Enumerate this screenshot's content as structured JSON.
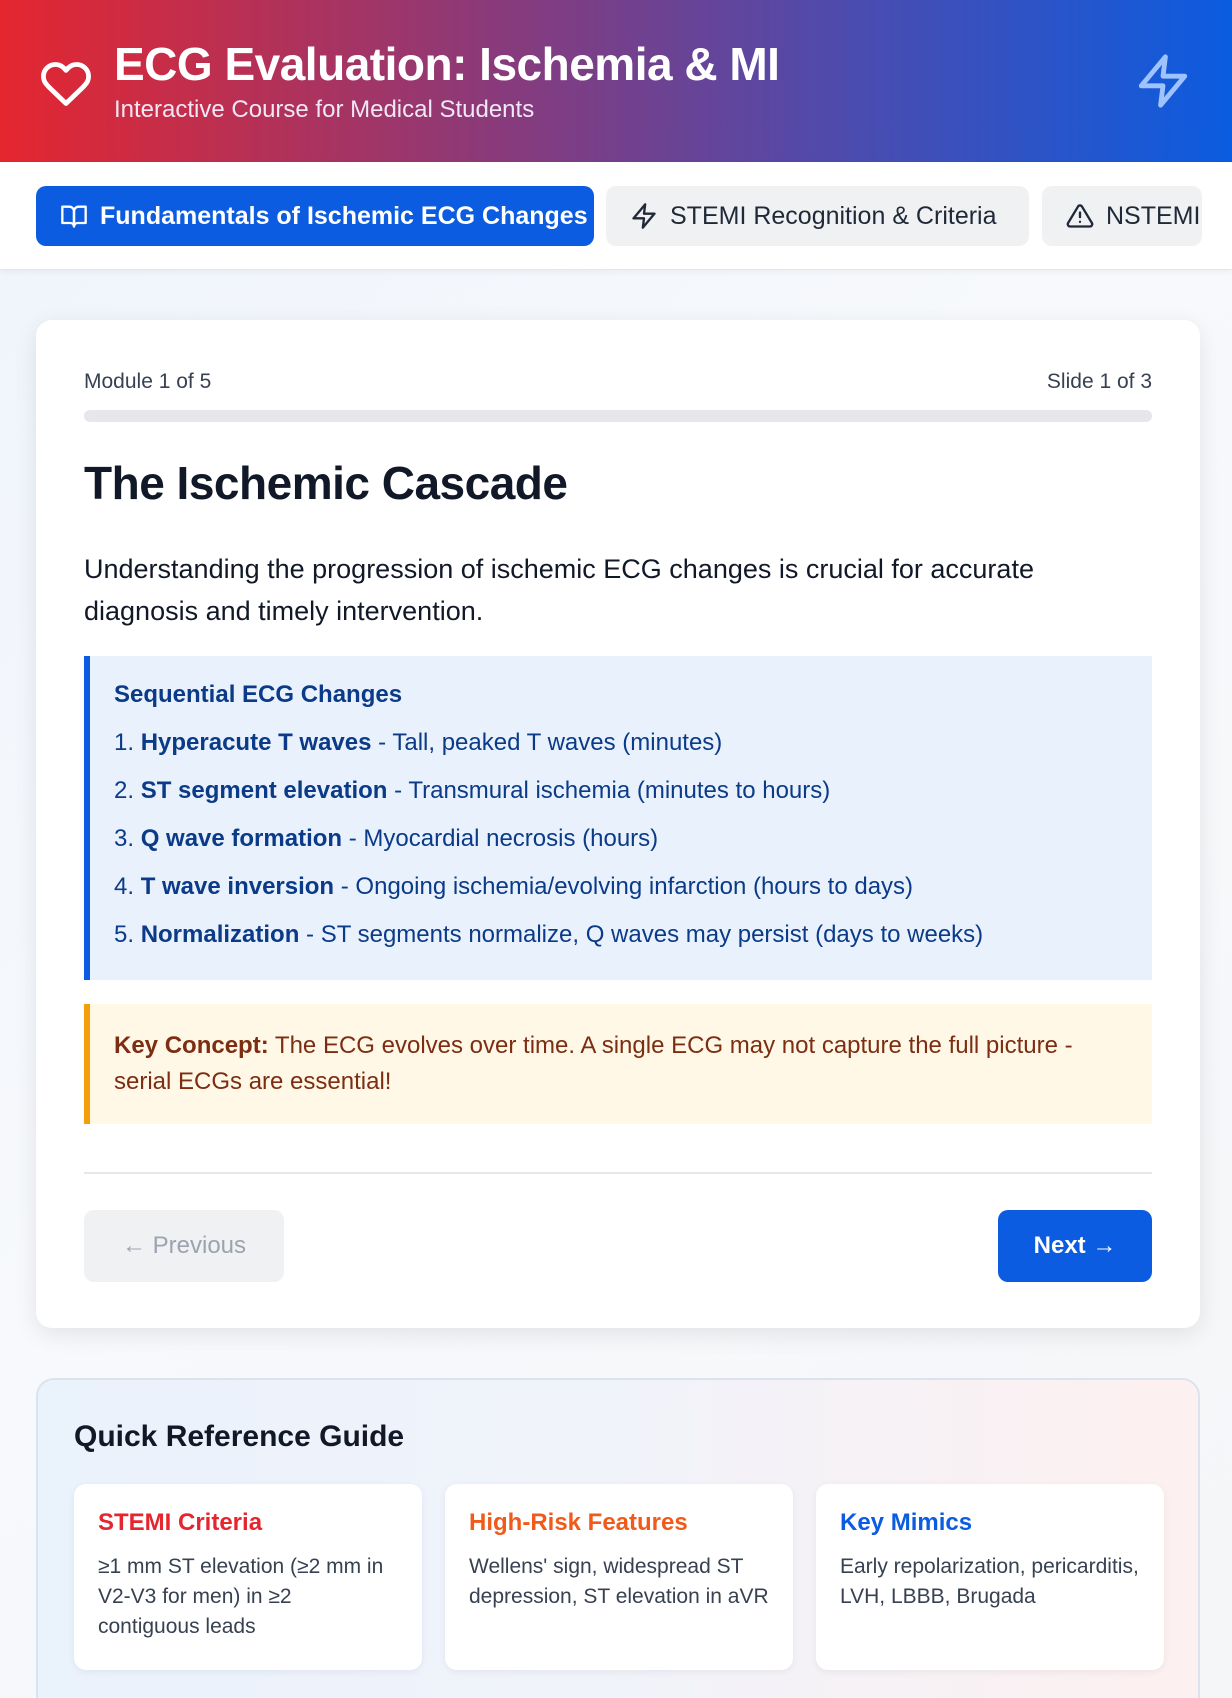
{
  "header": {
    "title": "ECG Evaluation: Ischemia & MI",
    "subtitle": "Interactive Course for Medical Students"
  },
  "tabs": [
    {
      "label": "Fundamentals of Ischemic ECG Changes",
      "icon": "book-icon",
      "active": true
    },
    {
      "label": "STEMI Recognition & Criteria",
      "icon": "bolt-icon",
      "active": false
    },
    {
      "label": "NSTEMI",
      "icon": "warning-icon",
      "active": false
    }
  ],
  "slide": {
    "module_text": "Module 1 of 5",
    "slide_text": "Slide 1 of 3",
    "progress_fraction": 0.0,
    "title": "The Ischemic Cascade",
    "intro": "Understanding the progression of ischemic ECG changes is crucial for accurate diagnosis and timely intervention.",
    "sequence": {
      "heading": "Sequential ECG Changes",
      "items": [
        {
          "num": "1.",
          "term": "Hyperacute T waves",
          "desc": " - Tall, peaked T waves (minutes)"
        },
        {
          "num": "2.",
          "term": "ST segment elevation",
          "desc": " - Transmural ischemia (minutes to hours)"
        },
        {
          "num": "3.",
          "term": "Q wave formation",
          "desc": " - Myocardial necrosis (hours)"
        },
        {
          "num": "4.",
          "term": "T wave inversion",
          "desc": " - Ongoing ischemia/evolving infarction (hours to days)"
        },
        {
          "num": "5.",
          "term": "Normalization",
          "desc": " - ST segments normalize, Q waves may persist (days to weeks)"
        }
      ]
    },
    "key_concept": {
      "label": "Key Concept:",
      "text": " The ECG evolves over time. A single ECG may not capture the full picture - serial ECGs are essential!"
    },
    "prev_label": "← Previous",
    "next_label": "Next →"
  },
  "quick_reference": {
    "title": "Quick Reference Guide",
    "cards": [
      {
        "title": "STEMI Criteria",
        "text": "≥1 mm ST elevation (≥2 mm in V2-V3 for men) in ≥2 contiguous leads"
      },
      {
        "title": "High-Risk Features",
        "text": "Wellens' sign, widespread ST depression, ST elevation in aVR"
      },
      {
        "title": "Key Mimics",
        "text": "Early repolarization, pericarditis, LVH, LBBB, Brugada"
      }
    ]
  },
  "colors": {
    "accent": "#0b5ce0",
    "stemi": "#e5262f",
    "high_risk": "#f05a1a",
    "warning": "#f59e0b"
  }
}
